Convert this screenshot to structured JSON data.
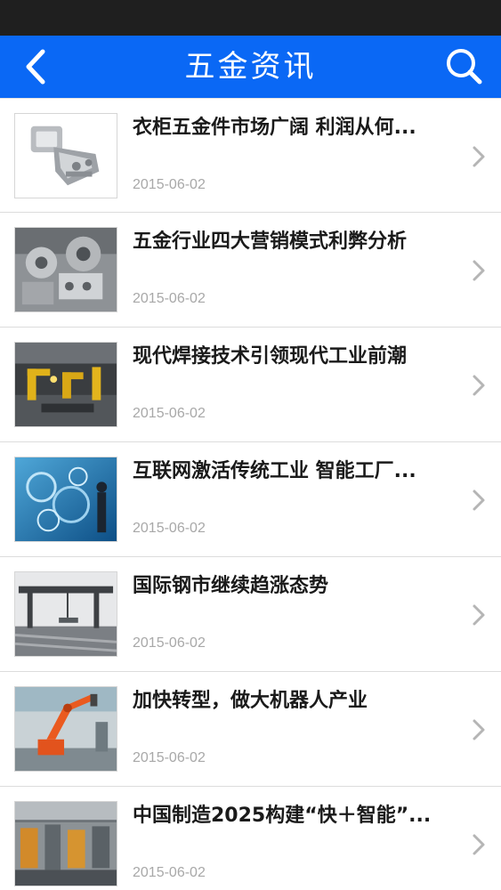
{
  "header": {
    "title": "五金资讯",
    "back_icon": "back-arrow-icon",
    "search_icon": "search-icon",
    "accent_color": "#0a68f5"
  },
  "news": [
    {
      "title": "衣柜五金件市场广阔 利润从何...",
      "date": "2015-06-02",
      "thumb": "cabinet-hinge"
    },
    {
      "title": "五金行业四大营销模式利弊分析",
      "date": "2015-06-02",
      "thumb": "metal-parts"
    },
    {
      "title": "现代焊接技术引领现代工业前潮",
      "date": "2015-06-02",
      "thumb": "welding-robots"
    },
    {
      "title": "互联网激活传统工业 智能工厂...",
      "date": "2015-06-02",
      "thumb": "smart-factory"
    },
    {
      "title": "国际钢市继续趋涨态势",
      "date": "2015-06-02",
      "thumb": "steel-yard"
    },
    {
      "title": "加快转型，做大机器人产业",
      "date": "2015-06-02",
      "thumb": "industrial-robot"
    },
    {
      "title": "中国制造2025构建“快＋智能”...",
      "date": "2015-06-02",
      "thumb": "assembly-line"
    }
  ]
}
